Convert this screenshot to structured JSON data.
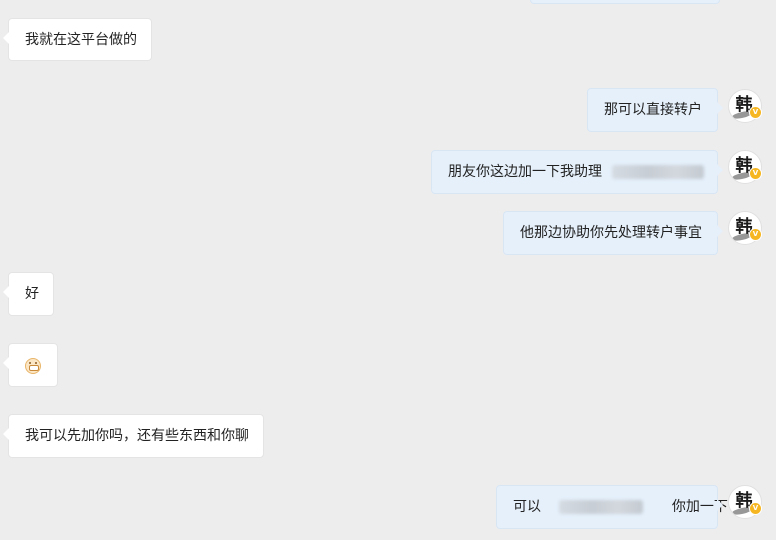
{
  "messages": [
    {
      "side": "left",
      "text": "我就在这平台做的"
    },
    {
      "side": "right",
      "text": "那可以直接转户"
    },
    {
      "side": "right",
      "text": "朋友你这边加一下我助理"
    },
    {
      "side": "right",
      "text": "他那边协助你先处理转户事宜"
    },
    {
      "side": "left",
      "text": "好"
    },
    {
      "side": "left",
      "emoji": "grinning-face-icon"
    },
    {
      "side": "left",
      "text": "我可以先加你吗，还有些东西和你聊"
    },
    {
      "side": "right",
      "text_before": "可以",
      "text_after": "你加一下"
    }
  ],
  "avatar": {
    "glyph": "韩",
    "badge": "V",
    "badge_color": "#f5b622"
  },
  "colors": {
    "background": "#ededed",
    "incoming_bubble": "#ffffff",
    "outgoing_bubble": "#e5f0fb"
  }
}
